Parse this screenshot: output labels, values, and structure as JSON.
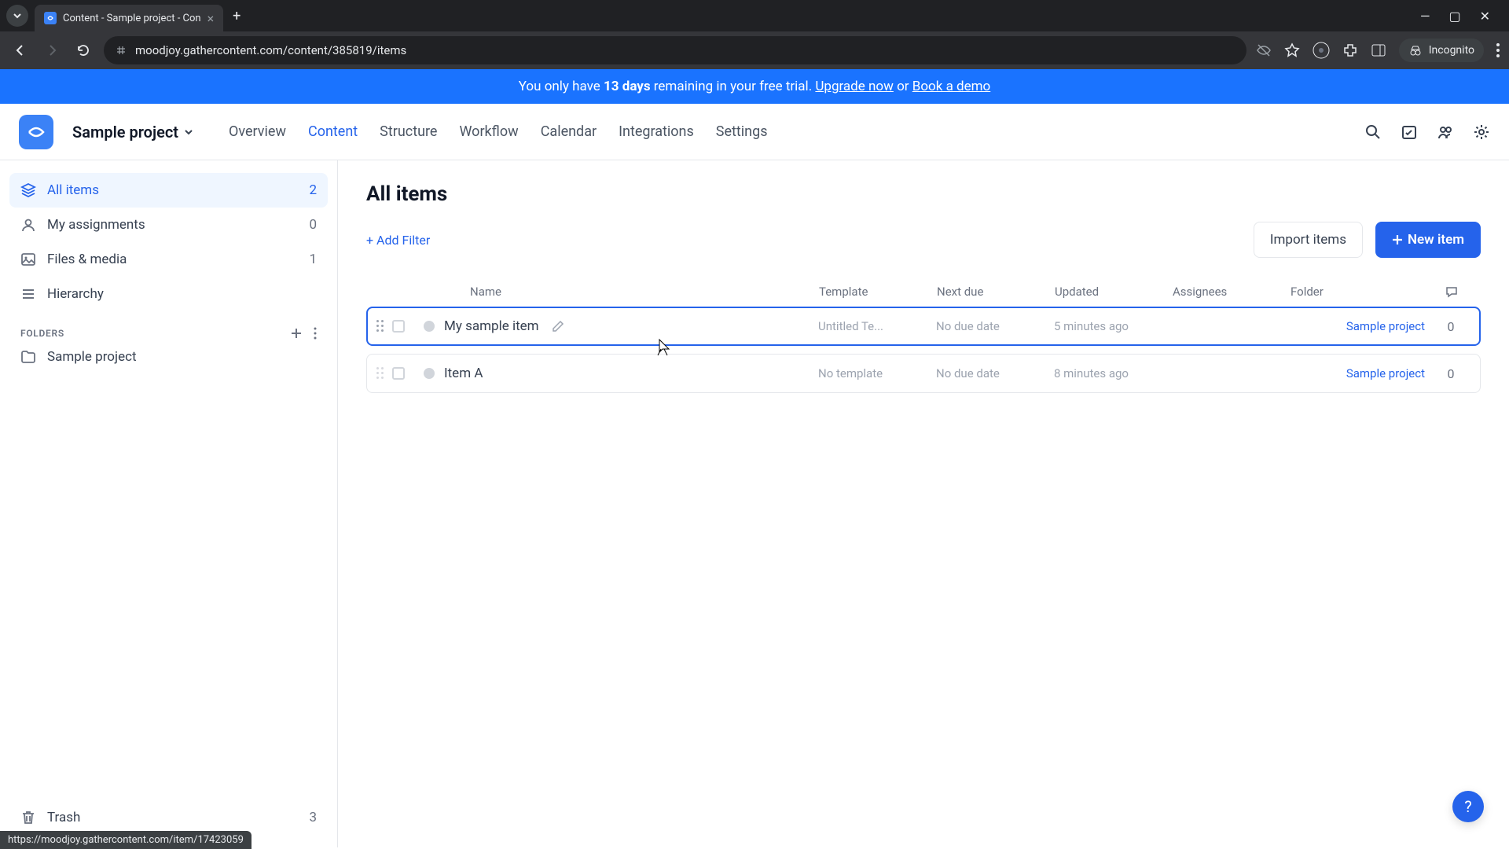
{
  "browser": {
    "tab_title": "Content - Sample project - Con",
    "url": "moodjoy.gathercontent.com/content/385819/items",
    "incognito_label": "Incognito",
    "link_preview": "https://moodjoy.gathercontent.com/item/17423059"
  },
  "trial": {
    "prefix": "You only have ",
    "days": "13 days",
    "middle": " remaining in your free trial. ",
    "upgrade": "Upgrade now",
    "or": " or ",
    "demo": "Book a demo"
  },
  "header": {
    "project_name": "Sample project",
    "tabs": [
      "Overview",
      "Content",
      "Structure",
      "Workflow",
      "Calendar",
      "Integrations",
      "Settings"
    ]
  },
  "sidebar": {
    "items": [
      {
        "label": "All items",
        "count": "2"
      },
      {
        "label": "My assignments",
        "count": "0"
      },
      {
        "label": "Files & media",
        "count": "1"
      },
      {
        "label": "Hierarchy",
        "count": ""
      }
    ],
    "folders_label": "FOLDERS",
    "folders": [
      {
        "label": "Sample project"
      }
    ],
    "trash": {
      "label": "Trash",
      "count": "3"
    }
  },
  "main": {
    "title": "All items",
    "add_filter": "+ Add Filter",
    "import_btn": "Import items",
    "new_item_btn": "New item",
    "columns": [
      "Name",
      "Template",
      "Next due",
      "Updated",
      "Assignees",
      "Folder"
    ],
    "rows": [
      {
        "name": "My sample item",
        "template": "Untitled Te...",
        "next_due": "No due date",
        "updated": "5 minutes ago",
        "assignees": "",
        "folder": "Sample project",
        "comments": "0"
      },
      {
        "name": "Item A",
        "template": "No template",
        "next_due": "No due date",
        "updated": "8 minutes ago",
        "assignees": "",
        "folder": "Sample project",
        "comments": "0"
      }
    ]
  },
  "help": "?"
}
